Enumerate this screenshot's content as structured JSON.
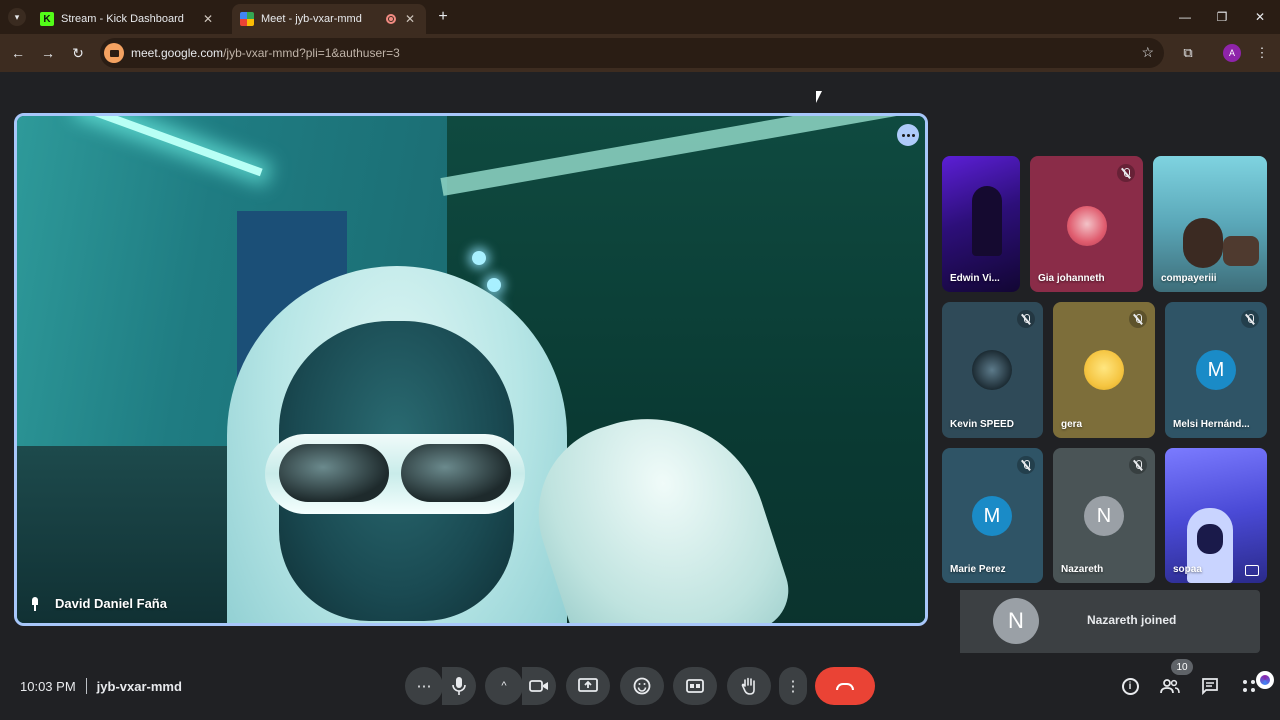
{
  "browser": {
    "tabs": [
      {
        "title": "Stream - Kick Dashboard",
        "favicon": "K"
      },
      {
        "title": "Meet - jyb-vxar-mmd",
        "active": true,
        "recording": true
      }
    ],
    "url_host": "meet.google.com",
    "url_path": "/jyb-vxar-mmd?pli=1&authuser=3",
    "profile_initial": "A"
  },
  "meeting": {
    "main_speaker": "David Daniel Faña",
    "time": "10:03 PM",
    "code": "jyb-vxar-mmd",
    "participant_count": "10"
  },
  "participants": [
    {
      "name": "Edwin Vi...",
      "muted": false
    },
    {
      "name": "Gia johanneth",
      "muted": true
    },
    {
      "name": "compayeriii",
      "muted": false
    },
    {
      "name": "Kevin SPEED",
      "muted": true
    },
    {
      "name": "gera",
      "muted": true
    },
    {
      "name": "Melsi Hernánd...",
      "muted": true,
      "initial": "M",
      "color": "#1a8bc7"
    },
    {
      "name": "Marie Perez",
      "muted": true,
      "initial": "M",
      "color": "#1a8bc7"
    },
    {
      "name": "Nazareth",
      "muted": true,
      "initial": "N",
      "color": "#9aa0a6"
    },
    {
      "name": "sopaa",
      "muted": false
    }
  ],
  "toast": {
    "initial": "N",
    "message": "Nazareth joined"
  },
  "colors": {
    "accent": "#a8c7fa",
    "hangup": "#ea4335",
    "control_bg": "#3c4043"
  }
}
